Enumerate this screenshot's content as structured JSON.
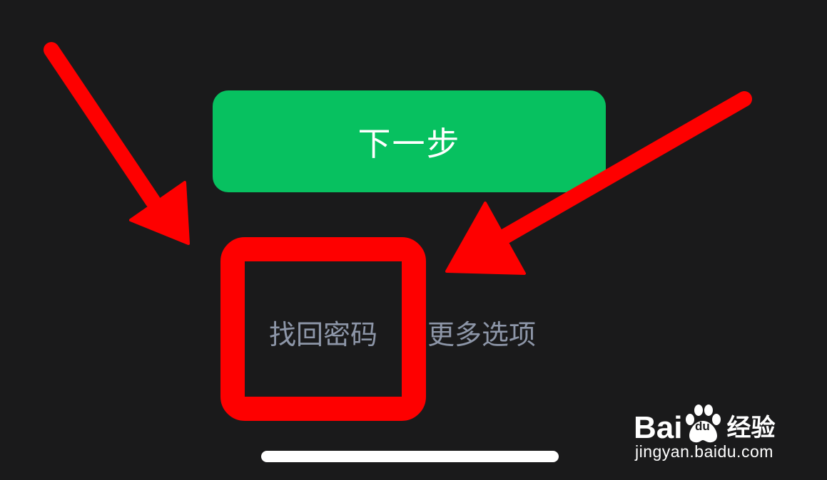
{
  "next_button": {
    "label": "下一步",
    "color": "#07c160"
  },
  "links": {
    "find_password": "找回密码",
    "more_options": "更多选项"
  },
  "annotation": {
    "color": "#fe0000"
  },
  "watermark": {
    "brand_prefix": "Bai",
    "brand_du": "du",
    "brand_suffix": "经验",
    "url": "jingyan.baidu.com"
  },
  "icons": {
    "baidu_paw": "baidu-paw-icon"
  }
}
